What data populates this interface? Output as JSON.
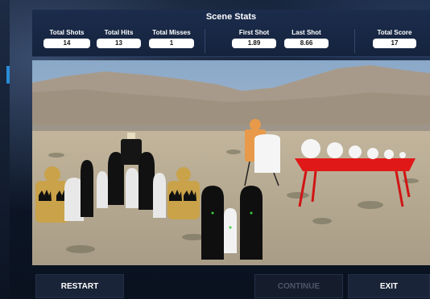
{
  "header": {
    "title": "Scene Stats",
    "stats": [
      {
        "label": "Total Shots",
        "value": "14"
      },
      {
        "label": "Total Hits",
        "value": "13"
      },
      {
        "label": "Total Misses",
        "value": "1"
      },
      {
        "label": "First Shot",
        "value": "1.89"
      },
      {
        "label": "Last Shot",
        "value": "8.66"
      },
      {
        "label": "Total Score",
        "value": "17"
      }
    ]
  },
  "footer": {
    "restart_label": "RESTART",
    "continue_label": "CONTINUE",
    "exit_label": "EXIT"
  },
  "colors": {
    "header_bg": "#1b2c4c",
    "sky": "#9fb6cf",
    "desert": "#b7ab96",
    "table_red": "#e01818",
    "target_tan": "#c9a24a",
    "steel_orange": "#e89a4a"
  }
}
